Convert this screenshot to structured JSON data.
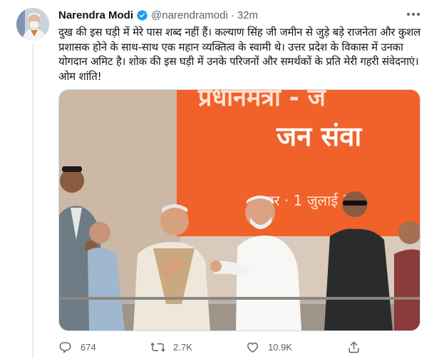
{
  "tweet": {
    "author_name": "Narendra Modi",
    "handle": "@narendramodi",
    "separator": "·",
    "time": "32m",
    "text": "दुख की इस घड़ी में मेरे पास शब्द नहीं हैं। कल्याण सिंह जी जमीन से जुड़े बड़े राजनेता और कुशल प्रशासक होने के साथ-साथ एक महान व्यक्तित्व के स्वामी थे। उत्तर प्रदेश के विकास में उनका योगदान अमिट है। शोक की इस घड़ी में उनके परिजनों और समर्थकों के प्रति मेरी गहरी संवेदनाएं। ओम शांति!",
    "colors": {
      "verified": "#1d9bf0",
      "secondary_text": "#536471",
      "banner_orange": "#f0622a"
    }
  },
  "media": {
    "banner_line1": "प्रधानमंत्री - ज",
    "banner_line2": "जन संवा",
    "banner_line3": "पुर · 1 जुलाई 2"
  },
  "actions": {
    "reply_count": "674",
    "retweet_count": "2.7K",
    "like_count": "10.9K"
  },
  "icons": [
    "verified-badge-icon",
    "more-icon",
    "reply-icon",
    "retweet-icon",
    "like-icon",
    "share-icon"
  ]
}
